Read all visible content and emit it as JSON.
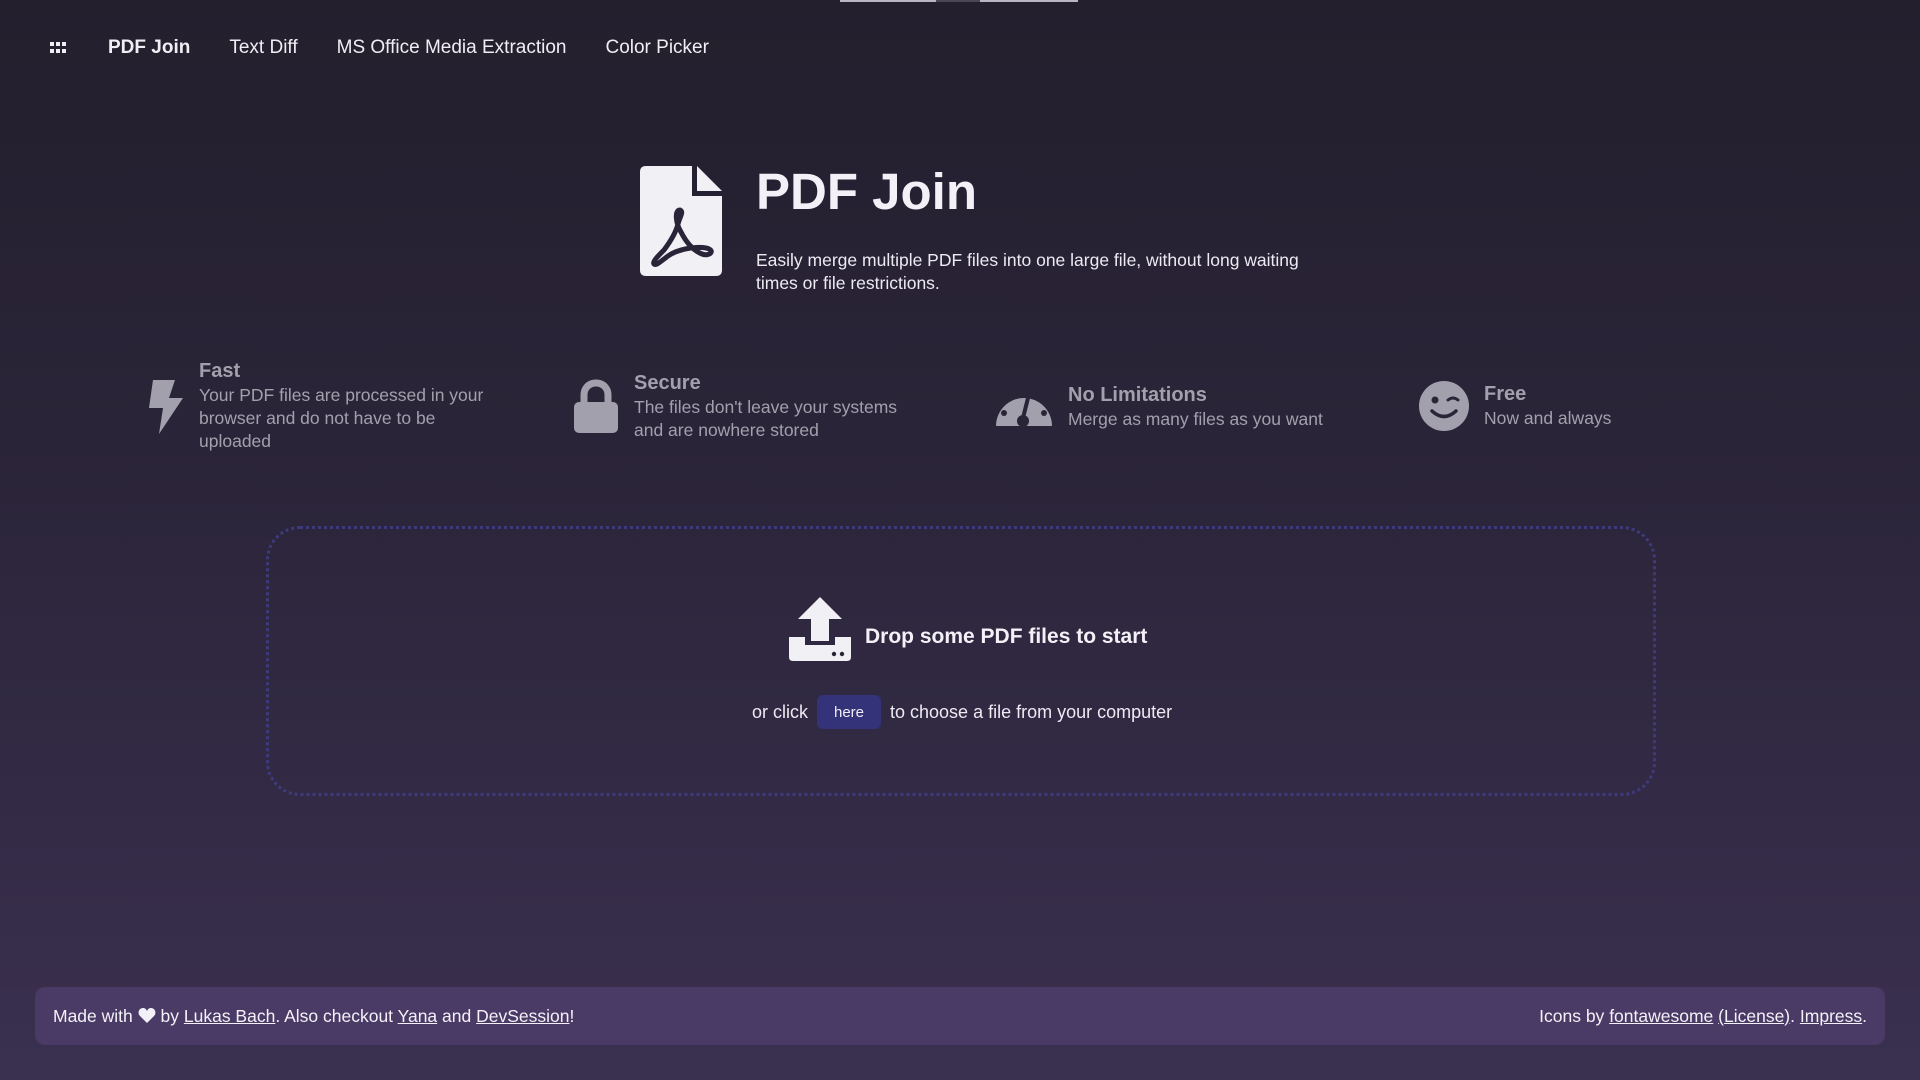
{
  "nav": {
    "menu_icon": "grid-icon",
    "items": [
      {
        "label": "PDF Join",
        "active": true
      },
      {
        "label": "Text Diff",
        "active": false
      },
      {
        "label": "MS Office Media Extraction",
        "active": false
      },
      {
        "label": "Color Picker",
        "active": false
      }
    ]
  },
  "hero": {
    "icon": "file-pdf-icon",
    "title": "PDF Join",
    "description": "Easily merge multiple PDF files into one large file, without long waiting times or file restrictions."
  },
  "features": [
    {
      "icon": "bolt-icon",
      "title": "Fast",
      "text": "Your PDF files are processed in your browser and do not have to be uploaded"
    },
    {
      "icon": "lock-icon",
      "title": "Secure",
      "text": "The files don't leave your systems and are nowhere stored"
    },
    {
      "icon": "gauge-icon",
      "title": "No Limitations",
      "text": "Merge as many files as you want"
    },
    {
      "icon": "wink-smile-icon",
      "title": "Free",
      "text": "Now and always"
    }
  ],
  "dropzone": {
    "icon": "upload-icon",
    "title": "Drop some PDF files to start",
    "pre_text": "or click",
    "button_label": "here",
    "post_text": "to choose a file from your computer"
  },
  "footer": {
    "made_with": "Made with",
    "heart_icon": "heart-icon",
    "by": "by",
    "author_link": "Lukas Bach",
    "also_text": ". Also checkout",
    "yana_link": "Yana",
    "and_text": "and",
    "devsession_link": "DevSession",
    "exclaim": "!",
    "icons_by": "Icons by",
    "fontawesome_link": "fontawesome",
    "license_link": "(License)",
    "dot": ".",
    "impress_link": "Impress",
    "dot2": "."
  },
  "colors": {
    "background_top": "#231f2d",
    "background_bottom": "#3a3050",
    "accent_button": "#34337a",
    "dropzone_border": "#3d3b7e",
    "footer_bg": "#4a3b66",
    "muted_text": "#a3a0ad"
  }
}
